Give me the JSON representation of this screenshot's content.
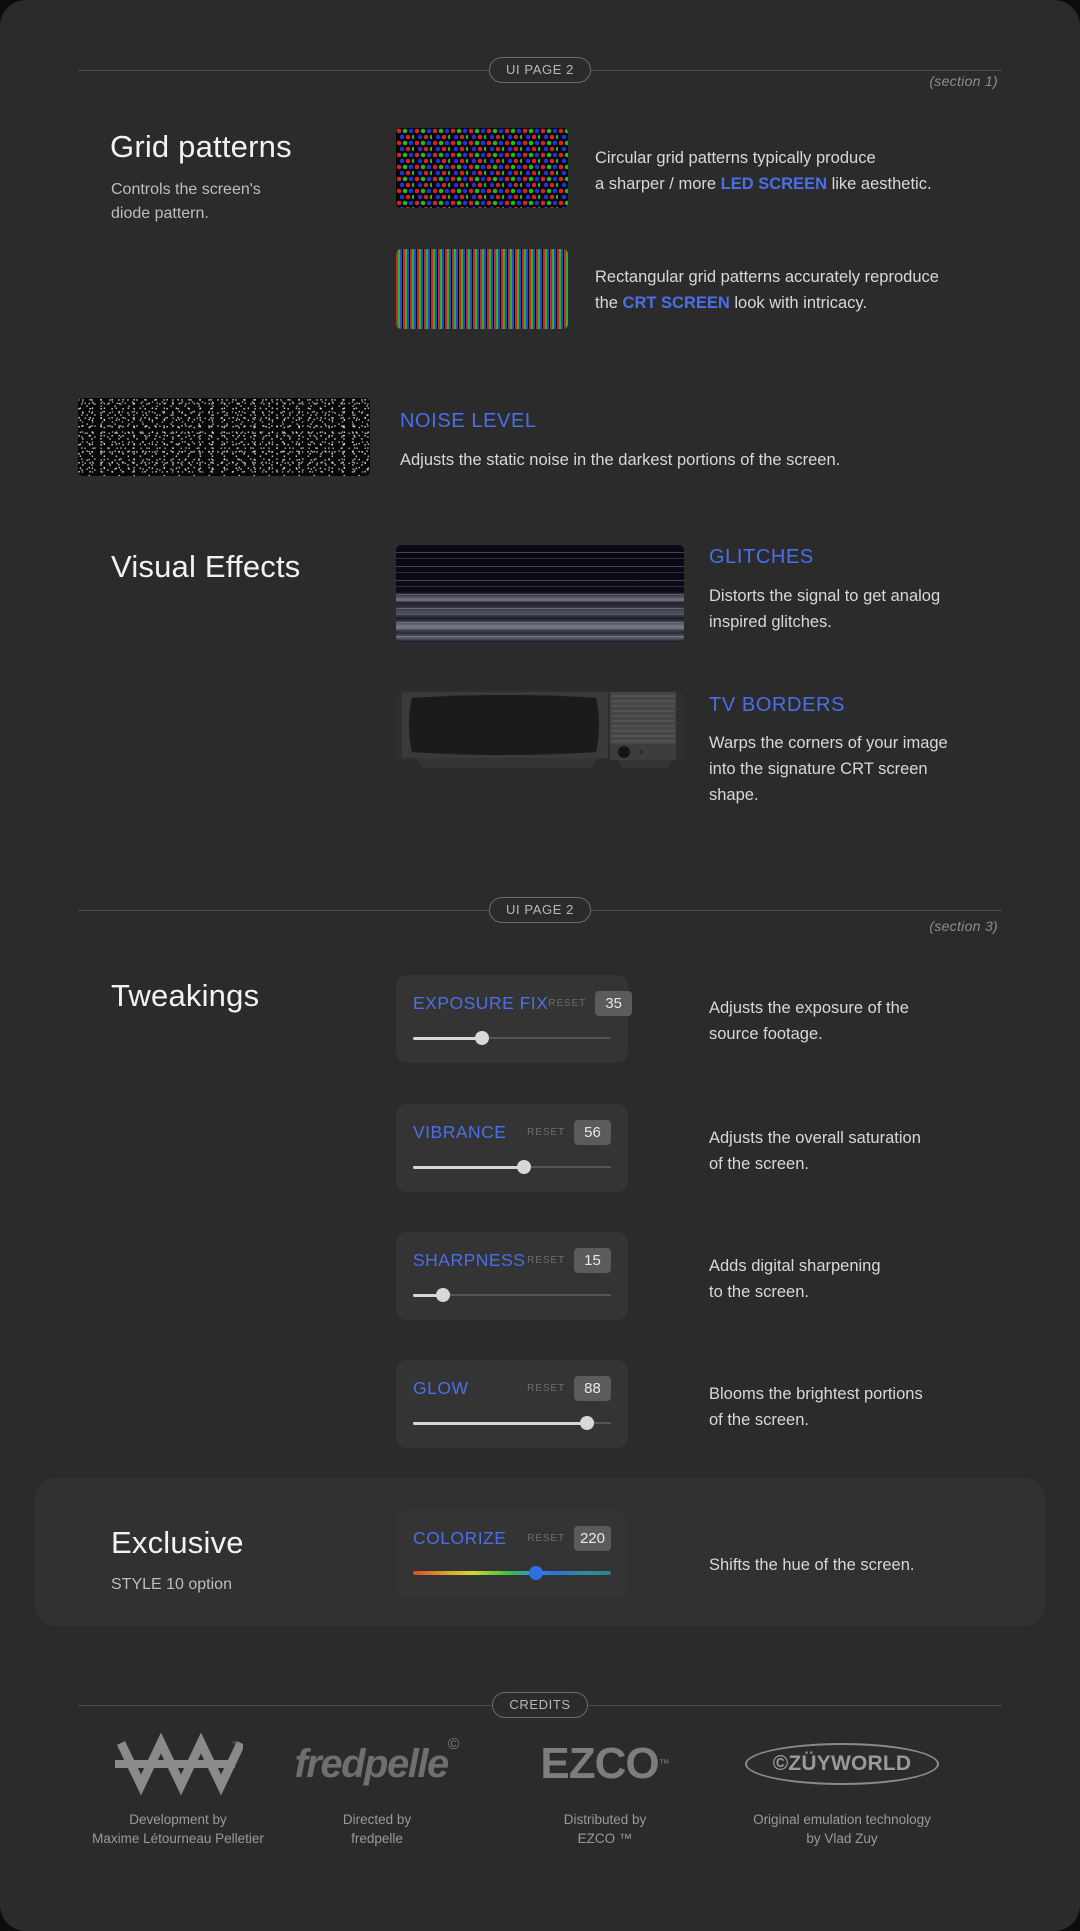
{
  "dividers": {
    "top_pill": "UI PAGE 2",
    "mid_pill": "UI PAGE 2",
    "credits_pill": "CREDITS"
  },
  "sections": {
    "tag1": "(section 1)",
    "tag3": "(section 3)"
  },
  "grid_patterns": {
    "title": "Grid patterns",
    "subtitle_line1": "Controls the screen's",
    "subtitle_line2": "diode pattern.",
    "circular": {
      "line1": "Circular grid patterns typically produce",
      "line2_pre": "a sharper / more ",
      "line2_accent": "LED SCREEN",
      "line2_post": " like aesthetic."
    },
    "rectangular": {
      "line1": "Rectangular grid patterns accurately reproduce",
      "line2_pre": "the ",
      "line2_accent": "CRT SCREEN",
      "line2_post": " look with intricacy."
    }
  },
  "noise": {
    "label": "NOISE LEVEL",
    "description": "Adjusts the static noise in the darkest portions of the screen."
  },
  "visual_effects": {
    "title": "Visual Effects",
    "glitches": {
      "label": "GLITCHES",
      "line1": "Distorts the signal to get  analog",
      "line2": "inspired glitches."
    },
    "tv_borders": {
      "label": "TV BORDERS",
      "line1": "Warps the corners of your image",
      "line2": "into the signature CRT screen",
      "line3": "shape."
    }
  },
  "tweakings": {
    "title": "Tweakings",
    "reset_label": "RESET",
    "sliders": [
      {
        "name": "EXPOSURE FIX",
        "value": "35",
        "percent": 35,
        "desc_line1": "Adjusts the exposure of the",
        "desc_line2": "source footage."
      },
      {
        "name": "VIBRANCE",
        "value": "56",
        "percent": 56,
        "desc_line1": "Adjusts the overall saturation",
        "desc_line2": "of the screen."
      },
      {
        "name": "SHARPNESS",
        "value": "15",
        "percent": 15,
        "desc_line1": "Adds digital sharpening",
        "desc_line2": "to the screen."
      },
      {
        "name": "GLOW",
        "value": "88",
        "percent": 88,
        "desc_line1": "Blooms the brightest portions",
        "desc_line2": "of the screen."
      }
    ]
  },
  "exclusive": {
    "title": "Exclusive",
    "subtitle": "STYLE 10 option",
    "slider": {
      "name": "COLORIZE",
      "reset_label": "RESET",
      "value": "220",
      "percent": 62,
      "description": "Shifts the hue of the screen."
    }
  },
  "credits": [
    {
      "logo": "waaa-logo",
      "logo_text": "",
      "caption_line1": "Development by",
      "caption_line2": "Maxime Létourneau Pelletier"
    },
    {
      "logo": "fredpelle-logo",
      "logo_text": "fredpelle",
      "caption_line1": "Directed by",
      "caption_line2": "fredpelle"
    },
    {
      "logo": "ezco-logo",
      "logo_text": "EZCO",
      "caption_line1": "Distributed by",
      "caption_line2": "EZCO ™"
    },
    {
      "logo": "zuyworld-logo",
      "logo_text": "©ZÜYWORLD",
      "caption_line1": "Original emulation technology",
      "caption_line2": "by Vlad Zuy"
    }
  ],
  "colors": {
    "accent": "#4a6fe8",
    "background": "#2b2b2b",
    "card": "#343434"
  }
}
